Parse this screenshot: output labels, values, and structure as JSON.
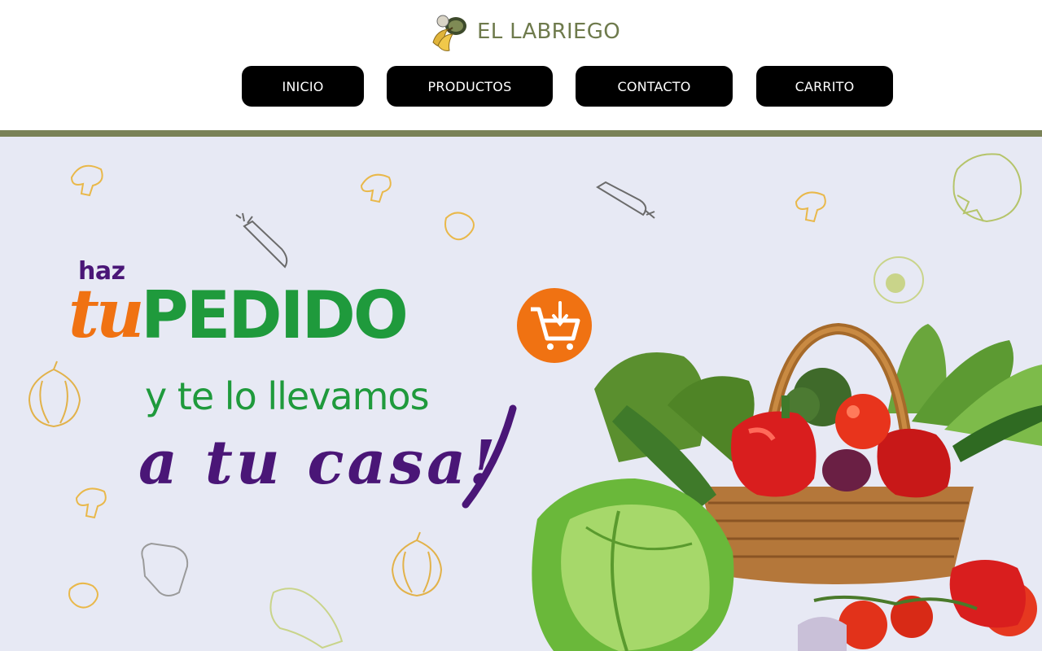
{
  "brand": {
    "name": "EL LABRIEGO",
    "logo_icon": "fruit-basket-icon"
  },
  "nav": {
    "items": [
      {
        "label": "INICIO"
      },
      {
        "label": "PRODUCTOS"
      },
      {
        "label": "CONTACTO"
      },
      {
        "label": "CARRITO"
      }
    ]
  },
  "hero": {
    "line_haz": "haz",
    "line_tu": "tu",
    "line_pedido": "PEDIDO",
    "line_llevamos": "y te lo llevamos",
    "line_casa": "a tu casa!",
    "cart_icon": "cart-download-icon",
    "image": "vegetable-basket-image"
  },
  "colors": {
    "brand_text": "#6e7a4c",
    "divider": "#7a8257",
    "nav_bg": "#000000",
    "hero_bg": "#e7e9f4",
    "green": "#1f9a3c",
    "orange": "#f07212",
    "purple": "#4a1677"
  }
}
